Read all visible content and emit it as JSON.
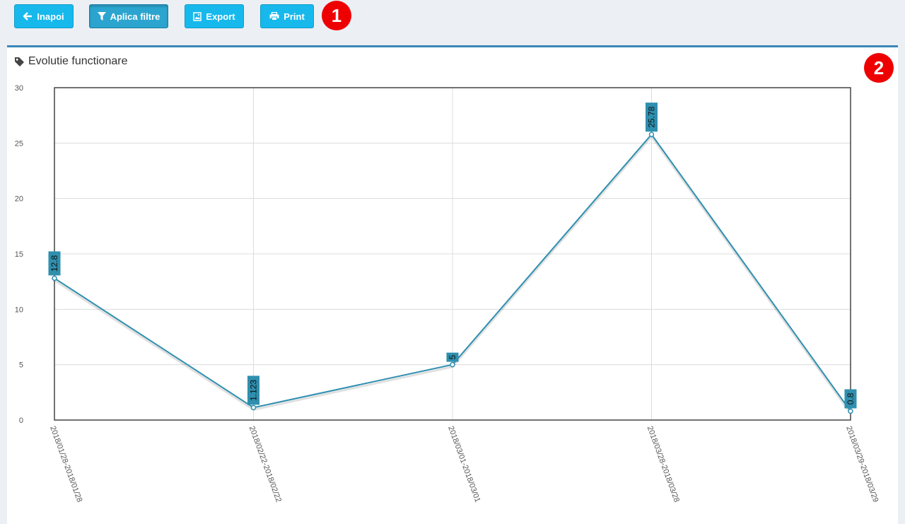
{
  "toolbar": {
    "back_label": "Inapoi",
    "filter_label": "Aplica filtre",
    "export_label": "Export",
    "print_label": "Print"
  },
  "markers": {
    "first": "1",
    "second": "2"
  },
  "panel": {
    "title": "Evolutie functionare"
  },
  "colors": {
    "button": "#17b9ec",
    "line": "#2e8fb0",
    "label_bg": "#2f8fae",
    "marker": "#ee0000"
  },
  "chart_data": {
    "type": "line",
    "title": "",
    "xlabel": "",
    "ylabel": "",
    "categories": [
      "2018/01/28-2018/01/28",
      "2018/02/22-2018/02/22",
      "2018/03/01-2018/03/01",
      "2018/03/28-2018/03/28",
      "2018/03/29-2018/03/29"
    ],
    "series": [
      {
        "values": [
          12.8,
          1.123,
          5,
          25.78,
          0.8
        ],
        "labels": [
          "12.8",
          "1.123",
          "5",
          "25.78",
          "0.8"
        ]
      }
    ],
    "ylim": [
      0,
      30
    ],
    "yticks": [
      0,
      5,
      10,
      15,
      20,
      25,
      30
    ],
    "grid": true,
    "legend": "none"
  }
}
